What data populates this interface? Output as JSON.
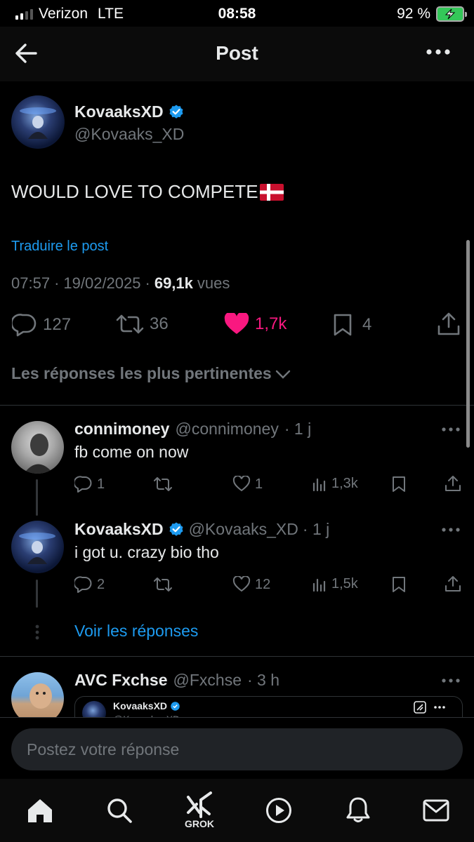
{
  "status_bar": {
    "carrier": "Verizon",
    "network": "LTE",
    "time": "08:58",
    "battery": "92 %",
    "battery_color": "#34c759"
  },
  "header": {
    "title": "Post",
    "back_icon": "arrow-left-icon",
    "more_icon": "more-horizontal-icon"
  },
  "post": {
    "author_name": "KovaaksXD",
    "author_handle": "@Kovaaks_XD",
    "text": "WOULD LOVE TO COMPETE",
    "flag_icon": "denmark-flag-icon",
    "translate_label": "Traduire le post",
    "time": "07:57",
    "date": "19/02/2025",
    "views_count": "69,1k",
    "views_label": "vues",
    "replies": "127",
    "reposts": "36",
    "likes": "1,7k",
    "bookmarks": "4",
    "like_color": "#f91880"
  },
  "sort": {
    "label": "Les réponses les plus pertinentes"
  },
  "replies": [
    {
      "name": "connimoney",
      "handle": "@connimoney",
      "age": "· 1 j",
      "text": "fb come on now",
      "replies": "1",
      "reposts": "",
      "likes": "1",
      "views": "1,3k"
    },
    {
      "name": "KovaaksXD",
      "handle": "@Kovaaks_XD",
      "age": "· 1 j",
      "text": "i got u. crazy bio tho",
      "replies": "2",
      "reposts": "",
      "likes": "12",
      "views": "1,5k"
    }
  ],
  "show_replies": "Voir les réponses",
  "third_reply": {
    "name": "AVC Fxchse",
    "handle": "@Fxchse",
    "age": "· 3 h",
    "quoted_name": "KovaaksXD",
    "quoted_handle": "@Kovaaks_XD"
  },
  "composer": {
    "placeholder": "Postez votre réponse"
  },
  "tabbar": {
    "grok_label": "GROK"
  },
  "accent_color": "#1d9bf0"
}
